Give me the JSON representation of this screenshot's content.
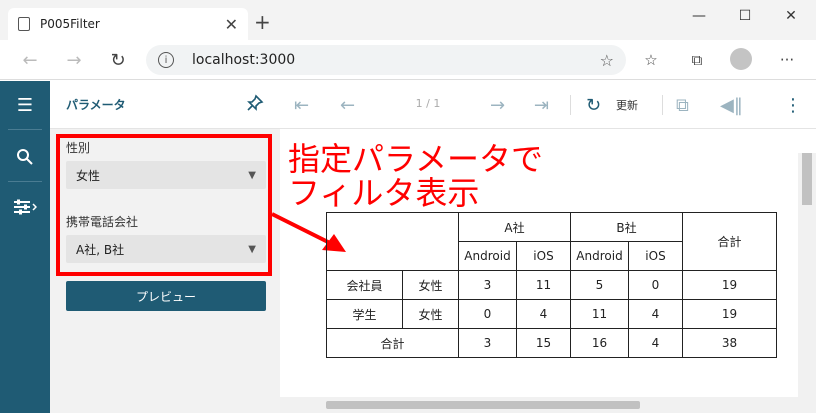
{
  "browser": {
    "tab_title": "P005Filter",
    "url": "localhost:3000"
  },
  "params": {
    "header_title": "パラメータ",
    "gender_label": "性別",
    "gender_value": "女性",
    "carrier_label": "携帯電話会社",
    "carrier_value": "A社, B社",
    "preview_label": "プレビュー"
  },
  "viewer": {
    "page_info": "1 / 1",
    "refresh_label": "更新"
  },
  "annotation": {
    "line1": "指定パラメータで",
    "line2": "フィルタ表示"
  },
  "report": {
    "company_a": "A社",
    "company_b": "B社",
    "total_header": "合計",
    "col_android": "Android",
    "col_ios": "iOS",
    "rows": [
      {
        "category": "会社員",
        "gender": "女性",
        "a_android": "3",
        "a_ios": "11",
        "b_android": "5",
        "b_ios": "0",
        "total": "19"
      },
      {
        "category": "学生",
        "gender": "女性",
        "a_android": "0",
        "a_ios": "4",
        "b_android": "11",
        "b_ios": "4",
        "total": "19"
      }
    ],
    "grand": {
      "label": "合計",
      "a_android": "3",
      "a_ios": "15",
      "b_android": "16",
      "b_ios": "4",
      "total": "38"
    }
  },
  "colors": {
    "brand": "#1f5b74",
    "annotation": "#ff0000"
  }
}
